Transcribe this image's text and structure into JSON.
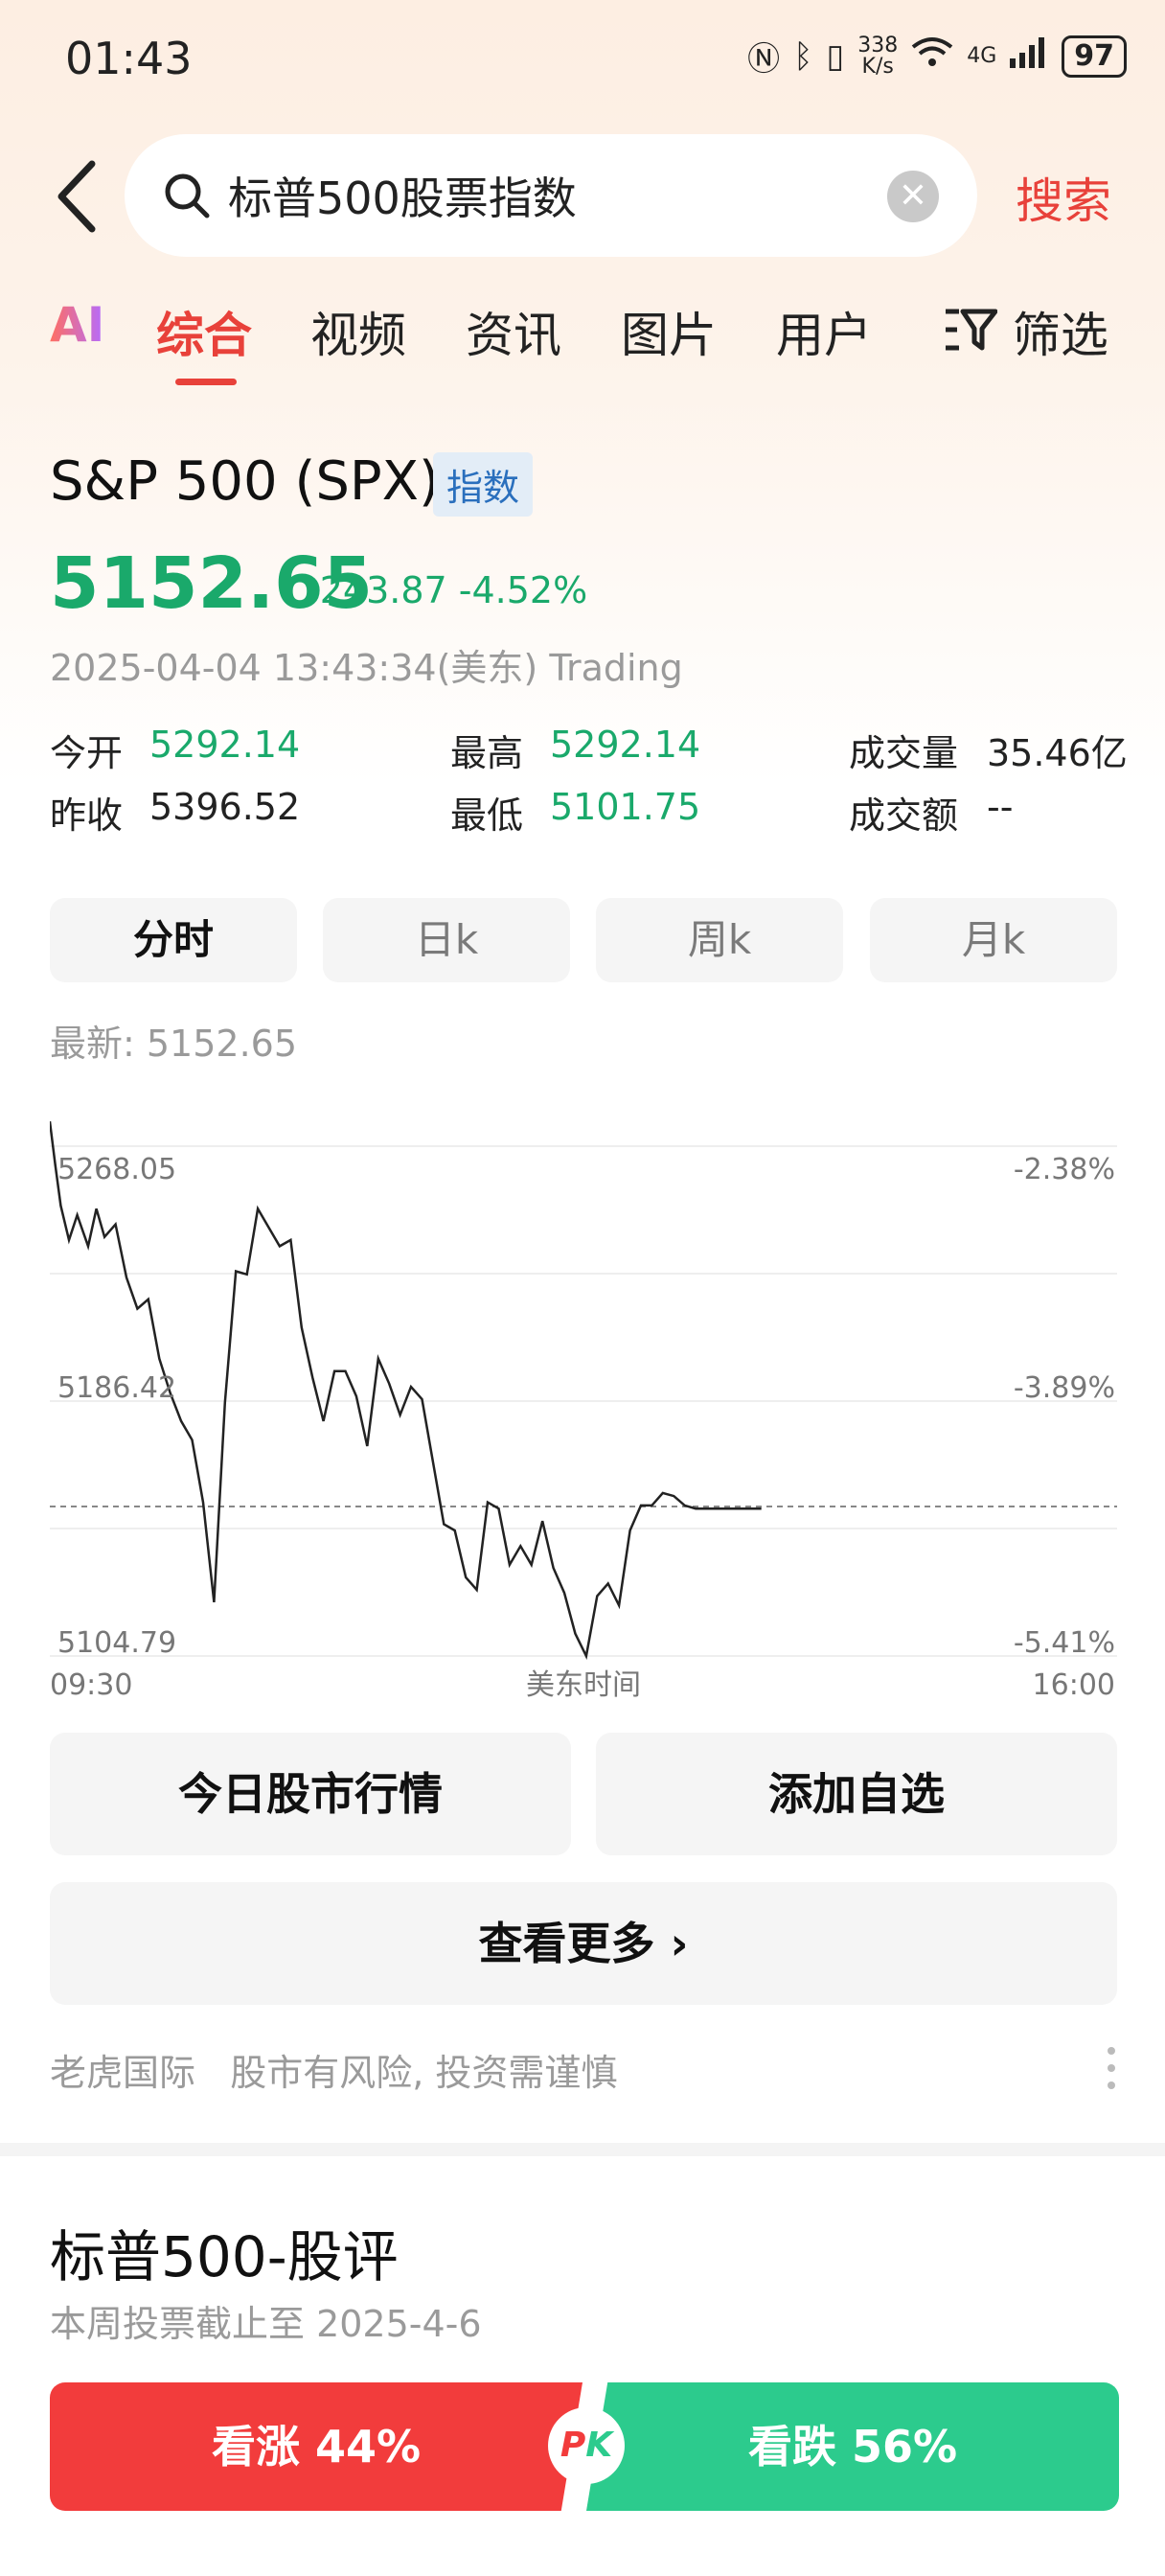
{
  "status_bar": {
    "time": "01:43",
    "speed_value": "338",
    "speed_unit": "K/s",
    "network": "4G",
    "battery": "97"
  },
  "search": {
    "query": "标普500股票指数",
    "submit_label": "搜索"
  },
  "tabs": [
    {
      "label": "AI"
    },
    {
      "label": "综合"
    },
    {
      "label": "视频"
    },
    {
      "label": "资讯"
    },
    {
      "label": "图片"
    },
    {
      "label": "用户"
    },
    {
      "label": "筛选"
    }
  ],
  "index": {
    "name": "S&P 500 (SPX)",
    "badge": "指数",
    "price": "5152.65",
    "change": "-243.87",
    "change_pct": "-4.52%",
    "timestamp": "2025-04-04 13:43:34(美东) Trading"
  },
  "stats": {
    "open_label": "今开",
    "open_value": "5292.14",
    "prev_label": "昨收",
    "prev_value": "5396.52",
    "high_label": "最高",
    "high_value": "5292.14",
    "low_label": "最低",
    "low_value": "5101.75",
    "volume_label": "成交量",
    "volume_value": "35.46亿",
    "turnover_label": "成交额",
    "turnover_value": "--"
  },
  "period_tabs": [
    "分时",
    "日k",
    "周k",
    "月k"
  ],
  "latest": "最新:  5152.65",
  "chart_data": {
    "type": "line",
    "x_start_label": "09:30",
    "x_mid_label": "美东时间",
    "x_end_label": "16:00",
    "y_labels_left": [
      "5268.05",
      "5186.42",
      "5104.79"
    ],
    "y_labels_right": [
      "-2.38%",
      "-3.89%",
      "-5.41%"
    ],
    "ylim": [
      5104.79,
      5268.05
    ],
    "reference_line": 5152.65,
    "x_minutes": [
      0,
      2,
      4,
      7,
      10,
      14,
      17,
      20,
      24,
      28,
      32,
      36,
      40,
      44,
      48,
      52,
      56,
      60,
      64,
      68,
      72,
      76,
      80,
      84,
      88,
      92,
      96,
      100,
      104,
      108,
      112,
      116,
      120,
      124,
      128,
      132,
      136,
      140,
      144,
      148,
      152,
      156,
      160,
      164,
      168,
      172,
      176,
      180,
      184,
      188,
      192,
      196,
      200,
      204,
      208,
      212,
      216,
      220,
      224,
      228,
      232,
      236,
      240,
      244,
      248,
      252,
      256,
      260
    ],
    "values": [
      5276,
      5262,
      5249,
      5238,
      5246,
      5236,
      5248,
      5239,
      5243,
      5226,
      5216,
      5219,
      5200,
      5189,
      5180,
      5174,
      5154,
      5122,
      5186,
      5228,
      5227,
      5248,
      5242,
      5236,
      5238,
      5210,
      5194,
      5180,
      5196,
      5196,
      5188,
      5172,
      5200,
      5192,
      5182,
      5191,
      5187,
      5167,
      5147,
      5145,
      5130,
      5126,
      5154,
      5152,
      5134,
      5140,
      5134,
      5148,
      5133,
      5125,
      5112,
      5104,
      5124,
      5128,
      5121,
      5145,
      5153,
      5153,
      5157,
      5156,
      5153,
      5152,
      5152,
      5152,
      5152,
      5152,
      5152,
      5152
    ]
  },
  "actions": {
    "market_today": "今日股市行情",
    "add_watch": "添加自选",
    "view_more": "查看更多"
  },
  "footer_note": {
    "source": "老虎国际",
    "risk": "股市有风险, 投资需谨慎"
  },
  "review": {
    "title": "标普500-股评",
    "subtitle": "本周投票截止至 2025-4-6",
    "bull_label": "看涨 44%",
    "bear_label": "看跌 56%",
    "pk_p": "P",
    "pk_k": "K"
  }
}
